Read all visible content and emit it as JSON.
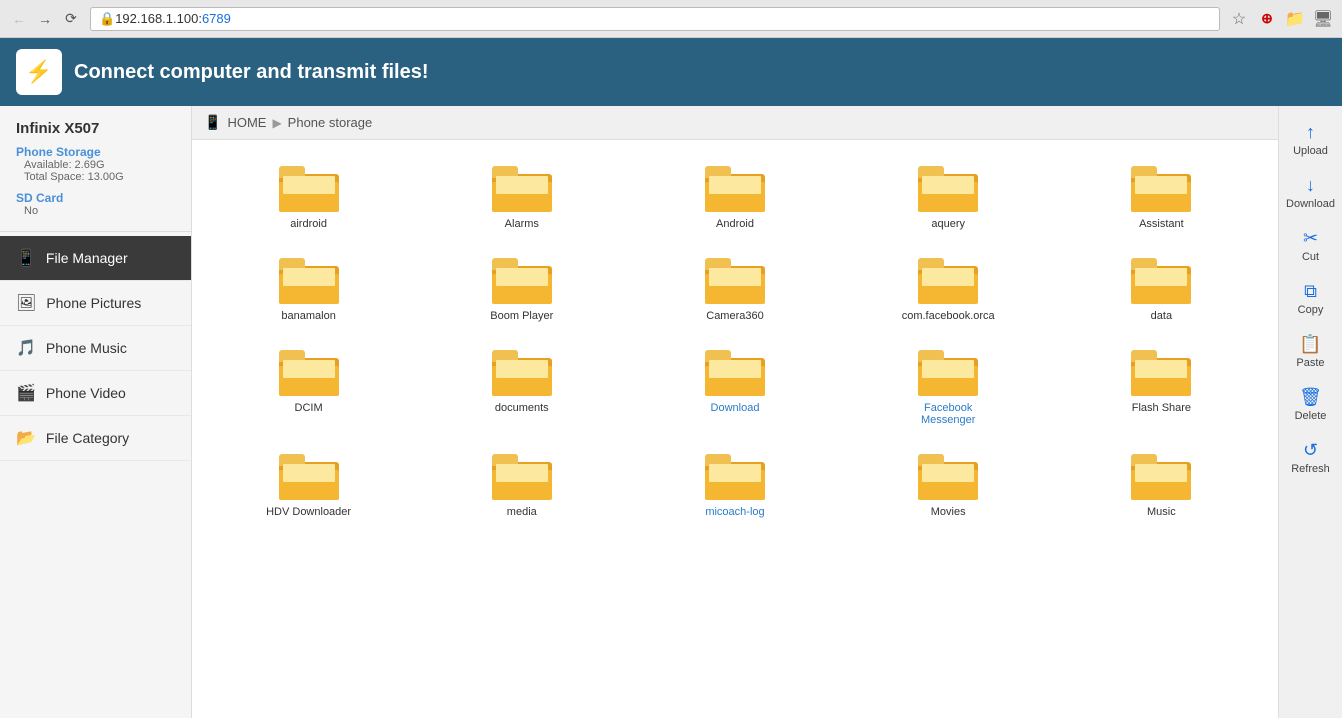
{
  "browser": {
    "url_base": "192.168.1.100:",
    "url_port": "6789",
    "back_disabled": true,
    "forward_disabled": false
  },
  "app": {
    "title": "Connect computer and transmit files!",
    "logo_icon": "⚡"
  },
  "device": {
    "name": "Infinix X507",
    "phone_storage_label": "Phone Storage",
    "available_label": "Available: 2.69G",
    "total_label": "Total Space: 13.00G",
    "sdcard_label": "SD Card",
    "sdcard_value": "No"
  },
  "sidebar": {
    "items": [
      {
        "id": "file-manager",
        "label": "File Manager",
        "icon": "📱",
        "active": true
      },
      {
        "id": "phone-pictures",
        "label": "Phone Pictures",
        "icon": "🖼"
      },
      {
        "id": "phone-music",
        "label": "Phone Music",
        "icon": "🎵"
      },
      {
        "id": "phone-video",
        "label": "Phone Video",
        "icon": "🎬"
      },
      {
        "id": "file-category",
        "label": "File Category",
        "icon": "📂"
      }
    ]
  },
  "breadcrumb": {
    "home": "HOME",
    "separator": "▶",
    "current": "Phone storage"
  },
  "folders": [
    {
      "name": "airdroid",
      "link": false
    },
    {
      "name": "Alarms",
      "link": false
    },
    {
      "name": "Android",
      "link": false
    },
    {
      "name": "aquery",
      "link": false
    },
    {
      "name": "Assistant",
      "link": false
    },
    {
      "name": "banamalon",
      "link": false
    },
    {
      "name": "Boom Player",
      "link": false
    },
    {
      "name": "Camera360",
      "link": false
    },
    {
      "name": "com.facebook.orca",
      "link": false
    },
    {
      "name": "data",
      "link": false
    },
    {
      "name": "DCIM",
      "link": false
    },
    {
      "name": "documents",
      "link": false
    },
    {
      "name": "Download",
      "link": true
    },
    {
      "name": "Facebook Messenger",
      "link": true
    },
    {
      "name": "Flash Share",
      "link": false
    },
    {
      "name": "HDV Downloader",
      "link": false
    },
    {
      "name": "media",
      "link": false
    },
    {
      "name": "micoach-log",
      "link": true
    },
    {
      "name": "Movies",
      "link": false
    },
    {
      "name": "Music",
      "link": false
    },
    {
      "name": "",
      "link": false
    },
    {
      "name": "",
      "link": false
    },
    {
      "name": "",
      "link": false
    },
    {
      "name": "",
      "link": false
    },
    {
      "name": "",
      "link": false
    }
  ],
  "toolbar": {
    "buttons": [
      {
        "id": "upload",
        "label": "Upload",
        "icon": "↑"
      },
      {
        "id": "download",
        "label": "Download",
        "icon": "↓"
      },
      {
        "id": "cut",
        "label": "Cut",
        "icon": "✂"
      },
      {
        "id": "copy",
        "label": "Copy",
        "icon": "⧉"
      },
      {
        "id": "paste",
        "label": "Paste",
        "icon": "📋"
      },
      {
        "id": "delete",
        "label": "Delete",
        "icon": "🗑"
      },
      {
        "id": "refresh",
        "label": "Refresh",
        "icon": "↺"
      }
    ]
  }
}
